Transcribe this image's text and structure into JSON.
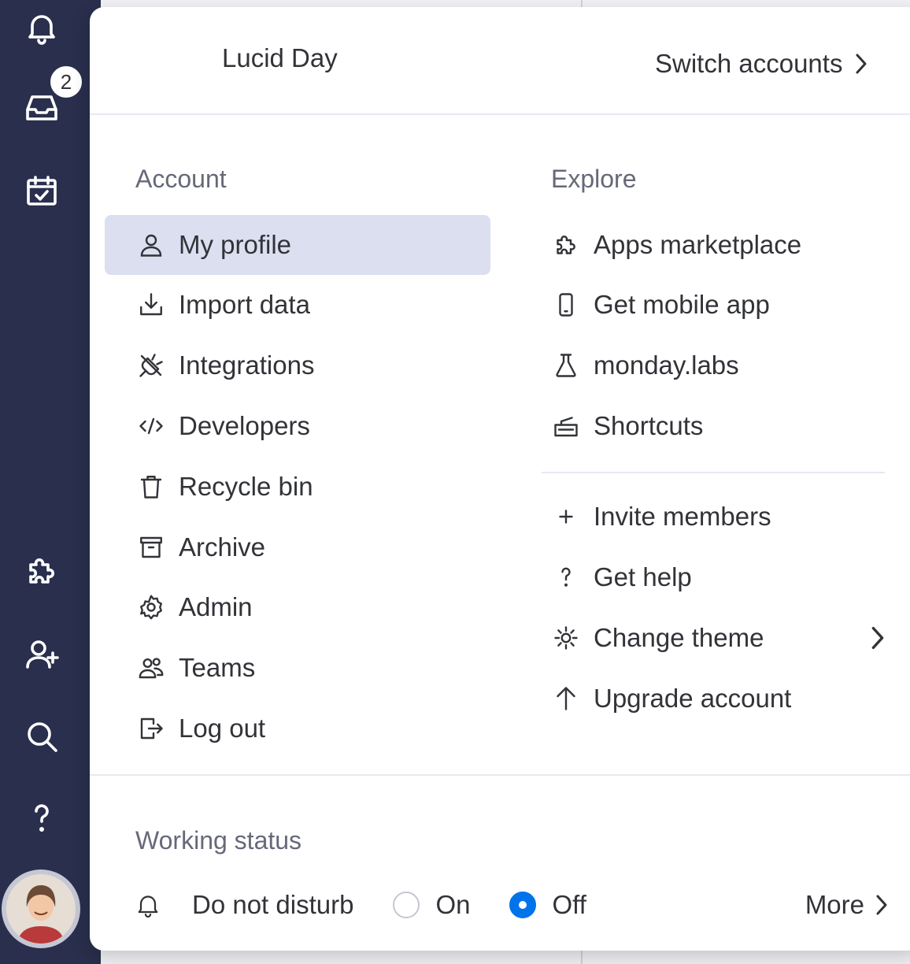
{
  "rail": {
    "inbox_badge": "2",
    "icons": [
      "bell-icon",
      "inbox-icon",
      "calendar-check-icon",
      "puzzle-icon",
      "add-user-icon",
      "search-icon",
      "help-icon"
    ]
  },
  "header": {
    "account_name": "Lucid Day",
    "switch_accounts_label": "Switch accounts"
  },
  "account": {
    "title": "Account",
    "items": [
      {
        "label": "My profile",
        "icon": "user-icon",
        "selected": true
      },
      {
        "label": "Import data",
        "icon": "download-icon"
      },
      {
        "label": "Integrations",
        "icon": "plug-icon"
      },
      {
        "label": "Developers",
        "icon": "code-icon"
      },
      {
        "label": "Recycle bin",
        "icon": "trash-icon"
      },
      {
        "label": "Archive",
        "icon": "archive-icon"
      },
      {
        "label": "Admin",
        "icon": "gear-icon"
      },
      {
        "label": "Teams",
        "icon": "team-icon"
      },
      {
        "label": "Log out",
        "icon": "logout-icon"
      }
    ]
  },
  "explore": {
    "title": "Explore",
    "items": [
      {
        "label": "Apps marketplace",
        "icon": "puzzle-icon"
      },
      {
        "label": "Get mobile app",
        "icon": "mobile-icon"
      },
      {
        "label": "monday.labs",
        "icon": "flask-icon"
      },
      {
        "label": "Shortcuts",
        "icon": "keyboard-icon"
      }
    ],
    "more_items": [
      {
        "label": "Invite members",
        "icon": "plus-icon"
      },
      {
        "label": "Get help",
        "icon": "question-icon"
      },
      {
        "label": "Change theme",
        "icon": "sun-icon"
      },
      {
        "label": "Upgrade account",
        "icon": "arrow-up-icon"
      }
    ]
  },
  "working_status": {
    "title": "Working status",
    "label": "Do not disturb",
    "on_label": "On",
    "off_label": "Off",
    "selected": "Off",
    "more_label": "More"
  },
  "colors": {
    "rail_bg": "#292f4c",
    "selected_bg": "#dcdff0",
    "radio_accent": "#0073ea",
    "text": "#323338",
    "muted": "#676879"
  }
}
